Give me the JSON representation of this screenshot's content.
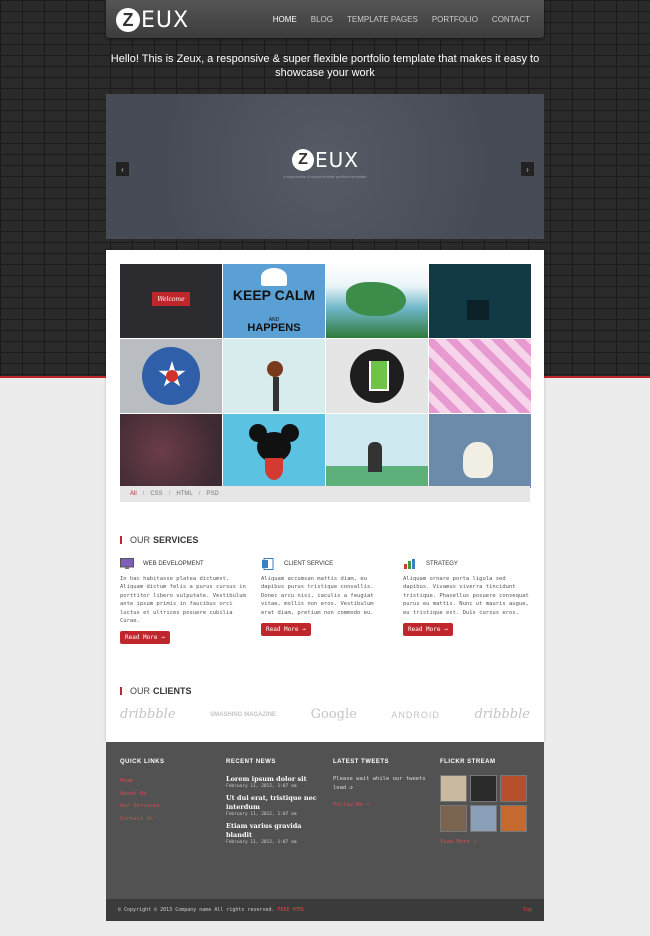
{
  "header": {
    "logo_letter": "Z",
    "logo_text": "EUX",
    "nav": [
      "HOME",
      "BLOG",
      "TEMPLATE PAGES",
      "PORTFOLIO",
      "CONTACT"
    ]
  },
  "tagline": "Hello! This is Zeux, a responsive & super flexible portfolio template that makes it easy to showcase your work",
  "slider": {
    "logo_letter": "Z",
    "logo_text": "EUX",
    "subtitle": "a responsive & super flexible portfolio template",
    "prev": "‹",
    "next": "›"
  },
  "portfolio": {
    "tiles": [
      "Welcome",
      "KEEP CALM",
      "",
      "",
      "",
      "",
      "",
      "",
      "",
      "",
      "",
      ""
    ],
    "keep_calm_small": "AND",
    "keep_calm_bottom": "HAPPENS",
    "filters": [
      "All",
      "CSS",
      "HTML",
      "PSD"
    ],
    "separator": "/"
  },
  "services": {
    "title_prefix": "OUR",
    "title_bold": "SERVICES",
    "items": [
      {
        "title": "WEB DEVELOPMENT",
        "icon": "monitor-icon",
        "text": "In hac habitasse platea dictumst. Aliquam dictum felis a purus cursus in porttitor libero vulputate. Vestibulum ante ipsum primis in faucibus orci luctus et ultrices posuere cubilia Curae.",
        "button": "Read More →"
      },
      {
        "title": "CLIENT SERVICE",
        "icon": "document-icon",
        "text": "Aliquam accumsan mattis diam, eu dapibus purus tristique convallis. Donec arcu nisi, iaculis a feugiat vitae, mollis non eros. Vestibulum erat diam, pretium non commodo eu.",
        "button": "Read More →"
      },
      {
        "title": "STRATEGY",
        "icon": "chart-icon",
        "text": "Aliquam ornare porta ligula sed dapibus. Vivamus viverra tincidunt tristique. Phasellus posuere consequat purus eu mattis. Nunc ut mauris augue, eu tristique est. Duis cursus eros.",
        "button": "Read More →"
      }
    ]
  },
  "clients": {
    "title_prefix": "OUR",
    "title_bold": "CLIENTS",
    "logos": [
      "dribbble",
      "SMASHING MAGAZINE",
      "Google",
      "ANDROID",
      "dribbble"
    ]
  },
  "footer": {
    "quick_links": {
      "title": "QUICK LINKS",
      "items": [
        "Home",
        "About Us",
        "Our Services",
        "Contact Us"
      ]
    },
    "recent_news": {
      "title": "RECENT NEWS",
      "items": [
        {
          "title": "Lorem ipsum dolor sit",
          "date": "February 11, 2012, 1:07 am"
        },
        {
          "title": "Ut dui erat, tristique nec interdum",
          "date": "February 11, 2012, 1:07 am"
        },
        {
          "title": "Etiam varius gravida blandit",
          "date": "February 11, 2012, 1:07 am"
        }
      ]
    },
    "tweets": {
      "title": "LATEST TWEETS",
      "text": "Please wait while our tweets load ↺",
      "follow": "Follow Me →"
    },
    "flickr": {
      "title": "FLICKR STREAM",
      "more": "View More →"
    }
  },
  "bottom": {
    "copyright": "© Copyright © 2013 Company name All rights reserved.",
    "copyright_link": "FREE HTML",
    "top": "Top"
  },
  "colors": {
    "accent": "#c0272d",
    "footer": "#525252"
  }
}
